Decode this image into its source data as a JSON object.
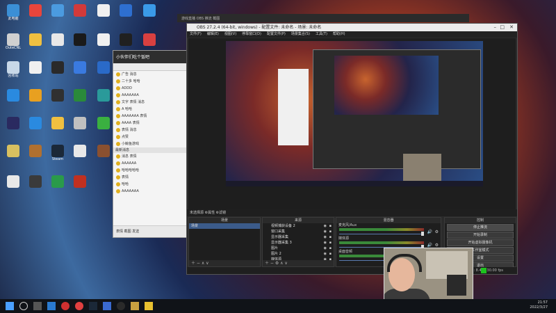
{
  "desktop": {
    "icons": [
      {
        "label": "此电脑",
        "color": "#3b8fd6"
      },
      {
        "label": "",
        "color": "#e8453c"
      },
      {
        "label": "",
        "color": "#4b9be0"
      },
      {
        "label": "",
        "color": "#d23a3a"
      },
      {
        "label": "",
        "color": "#f0f0f0"
      },
      {
        "label": "",
        "color": "#2e6fd0"
      },
      {
        "label": "",
        "color": "#3a9ae8"
      },
      {
        "label": "OuteCNL",
        "color": "#d0d0d0"
      },
      {
        "label": "",
        "color": "#f0c040"
      },
      {
        "label": "",
        "color": "#e8e8e8"
      },
      {
        "label": "",
        "color": "#1a1a1a"
      },
      {
        "label": "",
        "color": "#f0f0f0"
      },
      {
        "label": "",
        "color": "#202020"
      },
      {
        "label": "",
        "color": "#d84040"
      },
      {
        "label": "回收站",
        "color": "#c8d8e8"
      },
      {
        "label": "",
        "color": "#f0f0f0"
      },
      {
        "label": "",
        "color": "#2a2a2a"
      },
      {
        "label": "",
        "color": "#3a7ae0"
      },
      {
        "label": "",
        "color": "#2a6ac8"
      },
      {
        "label": "",
        "color": "#3a3a3a"
      },
      {
        "label": "",
        "color": "#e84848"
      },
      {
        "label": "",
        "color": "#2a8ae0"
      },
      {
        "label": "",
        "color": "#e8a020"
      },
      {
        "label": "",
        "color": "#303030"
      },
      {
        "label": "",
        "color": "#2a8a3a"
      },
      {
        "label": "",
        "color": "#2a9a9a"
      },
      {
        "label": "",
        "color": "#f0f0f0"
      },
      {
        "label": "",
        "color": "#d04020"
      },
      {
        "label": "",
        "color": "#2a2a60"
      },
      {
        "label": "",
        "color": "#2a8ae0"
      },
      {
        "label": "",
        "color": "#f0c040"
      },
      {
        "label": "",
        "color": "#c0c0c0"
      },
      {
        "label": "",
        "color": "#3ab040"
      },
      {
        "label": "",
        "color": "#e0a030"
      },
      {
        "label": "",
        "color": "#f0f0f0"
      },
      {
        "label": "",
        "color": "#d8c060"
      },
      {
        "label": "",
        "color": "#b07030"
      },
      {
        "label": "Steam",
        "color": "#1b2838"
      },
      {
        "label": "",
        "color": "#e8e8e8"
      },
      {
        "label": "",
        "color": "#8a5030"
      },
      {
        "label": "",
        "color": "#f0c020"
      },
      {
        "label": "",
        "color": "#c83030"
      },
      {
        "label": "",
        "color": "#e8e8e8"
      },
      {
        "label": "",
        "color": "#3a3a3a"
      },
      {
        "label": "",
        "color": "#2a9a4a"
      },
      {
        "label": "",
        "color": "#c03020"
      }
    ]
  },
  "background_window": {
    "title": "游戏直播 OBS 推流 截图"
  },
  "qq_window": {
    "title": "小伙伴们吃个饭吧",
    "messages": [
      "广告 消息",
      "二十多 哈哈",
      "ADDD",
      "AAAAAAA",
      "文字 表情 消息",
      "A 哈哈",
      "AAAAAAA 表情",
      "AAAA 表情",
      "表情 消息",
      "点赞",
      "小鲸鱼游戏",
      "消息 表情",
      "AAAAAA",
      "哈哈哈哈哈",
      "表情",
      "哈哈",
      "AAAAAAA"
    ],
    "separator": "最新消息",
    "footer_icons": "表情 截图 发送"
  },
  "obs": {
    "title": "OBS 27.2.4 (64-bit, windows) - 配置文件: 未命名 - 场景: 未命名",
    "menu": [
      "文件(F)",
      "编辑(E)",
      "视图(V)",
      "停靠窗口(D)",
      "配置文件(P)",
      "场景集合(S)",
      "工具(T)",
      "帮助(H)"
    ],
    "preview_bar": "未选择源   ⚙属性  ⚙滤镜",
    "scenes": {
      "header": "场景",
      "items": [
        "场景"
      ],
      "controls": "＋ − ∧ ∨"
    },
    "sources": {
      "header": "来源",
      "items": [
        "视频捕获设备 2",
        "窗口采集",
        "显示器采集",
        "显示器采集 3",
        "图片",
        "图片 2",
        "媒体源",
        "文本 (GDI+)",
        "视频捕获设备"
      ],
      "controls": "＋ − ⚙ ∧ ∨"
    },
    "mixer": {
      "header": "混音器",
      "channels": [
        {
          "name": "麦克风/Aux"
        },
        {
          "name": "媒体源"
        },
        {
          "name": "桌面音频"
        }
      ]
    },
    "controls": {
      "header": "控制",
      "buttons": [
        "停止推流",
        "开始录制",
        "开始虚拟摄像机",
        "工作室模式",
        "设置",
        "退出"
      ]
    },
    "status": "LIVE: 00:00:00   REC: 00:00:00   CPU: 8.4%, 30.00 fps"
  },
  "taskbar": {
    "clock": "21:57",
    "date": "2022/3/27"
  },
  "colors": {
    "obs_dark": "#2b2b2b",
    "live_green": "#1ec21e",
    "selected": "#3b5b8a"
  }
}
